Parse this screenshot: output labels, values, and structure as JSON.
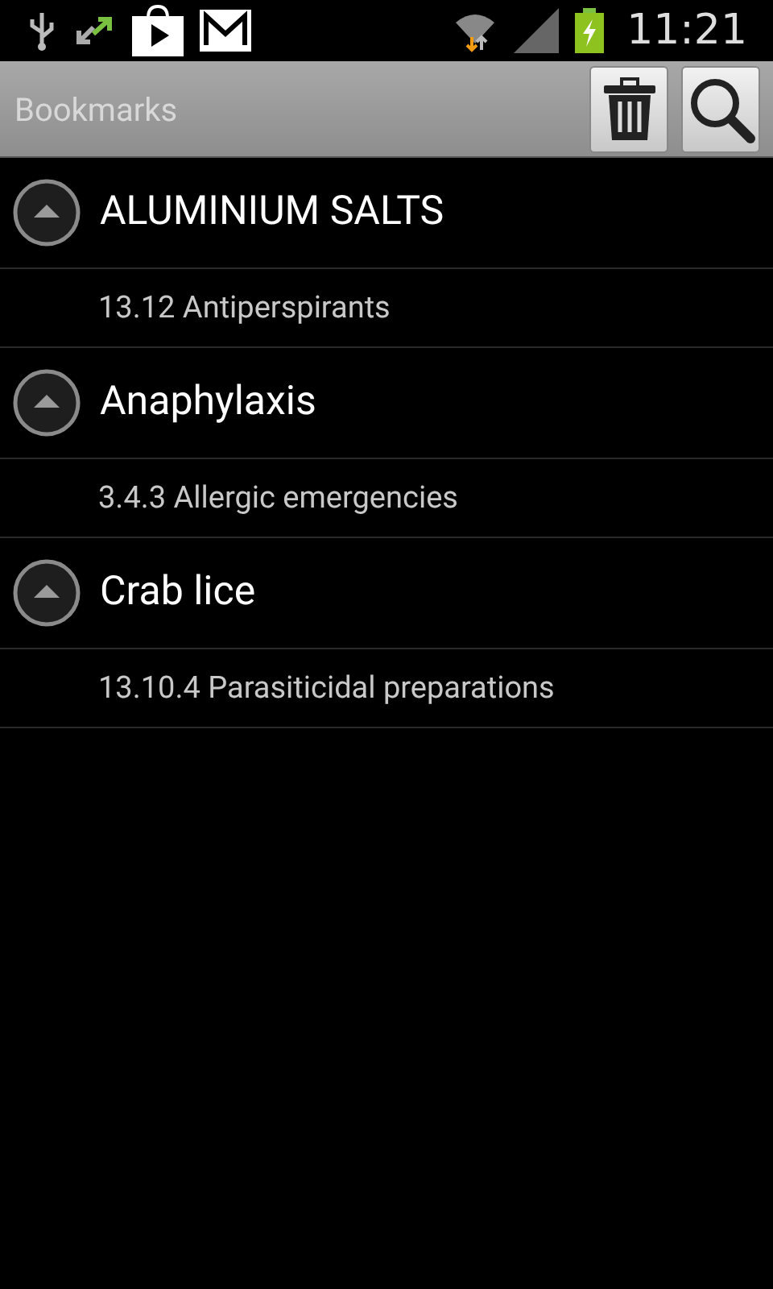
{
  "status_bar": {
    "time": "11:21"
  },
  "action_bar": {
    "title": "Bookmarks"
  },
  "groups": [
    {
      "title": "ALUMINIUM SALTS",
      "expanded": true,
      "children": [
        {
          "label": "13.12 Antiperspirants"
        }
      ]
    },
    {
      "title": "Anaphylaxis",
      "expanded": true,
      "children": [
        {
          "label": "3.4.3 Allergic emergencies"
        }
      ]
    },
    {
      "title": "Crab lice",
      "expanded": true,
      "children": [
        {
          "label": "13.10.4 Parasiticidal preparations"
        }
      ]
    }
  ]
}
